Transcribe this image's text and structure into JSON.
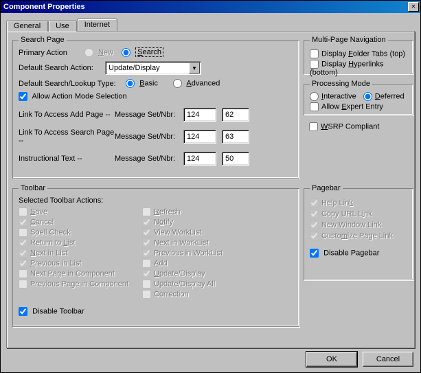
{
  "title": "Component Properties",
  "tabs": {
    "general": "General",
    "use": "Use",
    "internet": "Internet"
  },
  "search": {
    "legend": "Search Page",
    "primary_action_label": "Primary Action",
    "primary_action_new_html": "<span class=u>N</span>ew",
    "primary_action_search_html": "<span class=u>S</span>earch",
    "default_search_action_label": "Default Search Action:",
    "default_search_action_value": "Update/Display",
    "default_search_type_label": "Default Search/Lookup Type:",
    "default_search_type_basic_html": "<span class=u>B</span>asic",
    "default_search_type_advanced_html": "<span class=u>A</span>dvanced",
    "allow_action_mode": "Allow Action Mode Selection",
    "msg_setnbr_label": "Message Set/Nbr:",
    "rows": [
      {
        "label": "Link To Access Add Page --",
        "set": "124",
        "nbr": "62"
      },
      {
        "label": "Link To Access Search Page --",
        "set": "124",
        "nbr": "63"
      },
      {
        "label": "Instructional Text --",
        "set": "124",
        "nbr": "50"
      }
    ]
  },
  "multi": {
    "legend": "Multi-Page Navigation",
    "folder_tabs_html": "Display <span class=u>F</span>older Tabs (top)",
    "hyperlinks_html": "Display <span class=u>H</span>yperlinks (bottom)"
  },
  "proc": {
    "legend": "Processing Mode",
    "interactive_html": "<span class=u>I</span>nteractive",
    "deferred_html": "<span class=u>D</span>eferred",
    "expert_entry_html": "Allow <span class=u>E</span>xpert Entry"
  },
  "wsrp_html": "<span class=u>W</span>SRP Compliant",
  "toolbar": {
    "legend": "Toolbar",
    "subtitle": "Selected Toolbar Actions:",
    "left": [
      {
        "label_html": "<span class=u>S</span>ave",
        "checked": false
      },
      {
        "label_html": "<span class=u>C</span>ancel",
        "checked": true
      },
      {
        "label_html": "Spell Check",
        "checked": false
      },
      {
        "label_html": "Return to <span class=u>L</span>ist",
        "checked": true
      },
      {
        "label_html": "<span class=u>N</span>ext in List",
        "checked": true
      },
      {
        "label_html": "<span class=u>P</span>revious in List",
        "checked": true
      },
      {
        "label_html": "Next Page in Component",
        "checked": false
      },
      {
        "label_html": "Previous Page in Component",
        "checked": false
      }
    ],
    "right": [
      {
        "label_html": "<span class=u>R</span>efresh",
        "checked": false
      },
      {
        "label_html": "N<span class=u>o</span>tify",
        "checked": true
      },
      {
        "label_html": "View WorkList",
        "checked": true
      },
      {
        "label_html": "Next in WorkList",
        "checked": true
      },
      {
        "label_html": "Previous in WorkList",
        "checked": true
      },
      {
        "label_html": "<span class=u>A</span>dd",
        "checked": false
      },
      {
        "label_html": "<span class=u>U</span>pdate/Display",
        "checked": true
      },
      {
        "label_html": "Update/Display All",
        "checked": false
      },
      {
        "label_html": "Correction",
        "checked": false
      }
    ],
    "disable_toolbar": "Disable Toolbar"
  },
  "pagebar": {
    "legend": "Pagebar",
    "items": [
      {
        "label_html": "Help Lin<span class=u>k</span>",
        "checked": true
      },
      {
        "label_html": "Copy URL L<span class=u>i</span>nk",
        "checked": true
      },
      {
        "label_html": "New Window Link",
        "checked": true
      },
      {
        "label_html": "Custo<span class=u>m</span>ize Page Link",
        "checked": true
      }
    ],
    "disable_pagebar": "Disable Pagebar"
  },
  "buttons": {
    "ok": "OK",
    "cancel": "Cancel"
  }
}
